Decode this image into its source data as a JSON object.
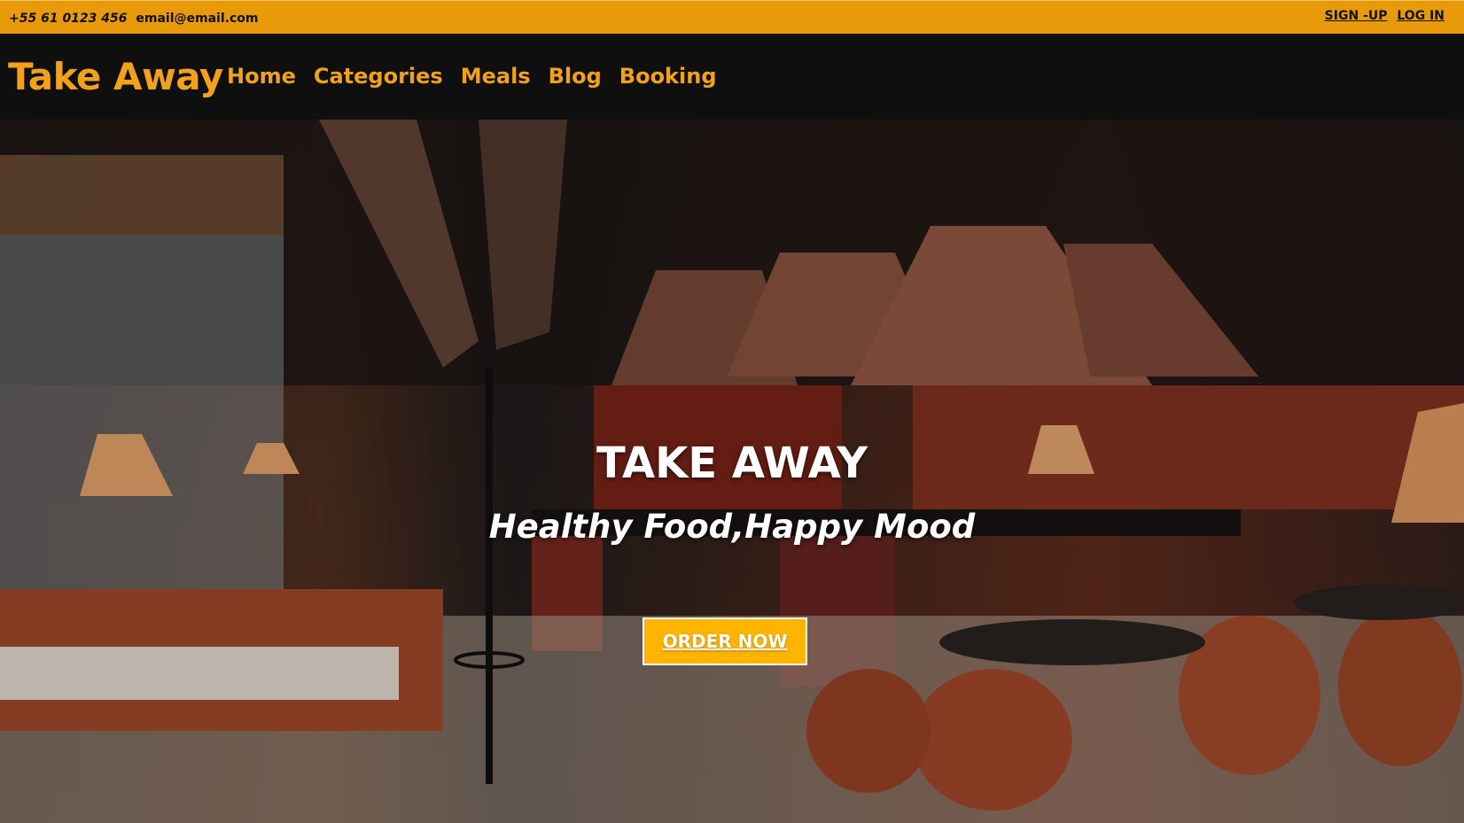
{
  "topbar": {
    "phone": "+55 61 0123 456",
    "email": "email@email.com",
    "signup_label": "SIGN -UP",
    "login_label": "LOG IN"
  },
  "navbar": {
    "logo": "Take Away",
    "links": [
      "Home",
      "Categories",
      "Meals",
      "Blog",
      "Booking"
    ]
  },
  "hero": {
    "title": "TAKE AWAY",
    "subtitle": "Healthy Food,Happy Mood",
    "cta_label": "ORDER NOW"
  },
  "colors": {
    "accent": "#e89a0a",
    "nav_text": "#f2a21a",
    "nav_bg": "#0f0f0f",
    "button": "#ffb400"
  }
}
